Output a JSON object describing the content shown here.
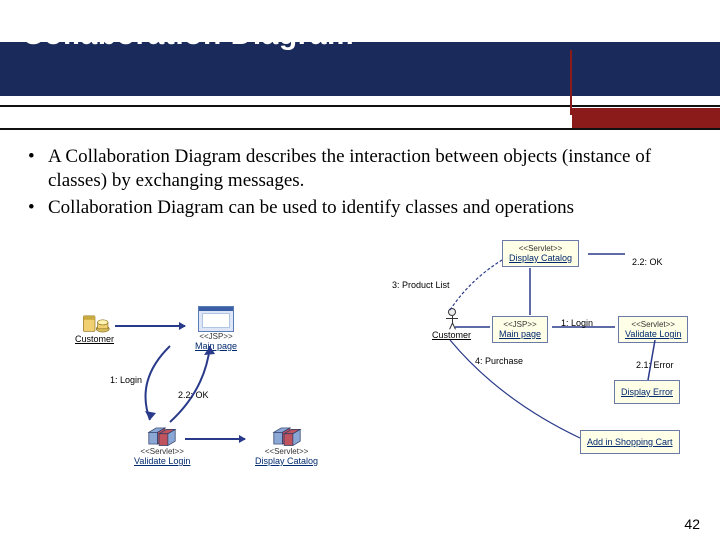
{
  "slide": {
    "title": "Collaboration Diagram",
    "page_number": "42",
    "bullets": [
      "A Collaboration Diagram describes the interaction between objects (instance of classes) by exchanging messages.",
      "Collaboration Diagram can be used to identify classes and operations"
    ]
  },
  "diagram_left": {
    "customer": "Customer",
    "main_page": {
      "stereotype": "<<JSP>>",
      "name": "Main page"
    },
    "validate_login": {
      "stereotype": "<<Servlet>>",
      "name": "Validate Login"
    },
    "display_catalog": {
      "stereotype": "<<Servlet>>",
      "name": "Display Catalog"
    },
    "m_login": "1: Login",
    "m_ok": "2.2: OK"
  },
  "diagram_right": {
    "display_catalog": {
      "stereotype": "<<Servlet>>",
      "name": "Display Catalog"
    },
    "customer": "Customer",
    "main_page": {
      "stereotype": "<<JSP>>",
      "name": "Main page"
    },
    "validate_login": {
      "stereotype": "<<Servlet>>",
      "name": "Validate Login"
    },
    "display_error": "Display Error",
    "add_cart": "Add in Shopping Cart",
    "m_product_list": "3: Product List",
    "m_login": "1: Login",
    "m_error": "2.1: Error",
    "m_purchase": "4: Purchase",
    "m_ok": "2.2: OK"
  }
}
